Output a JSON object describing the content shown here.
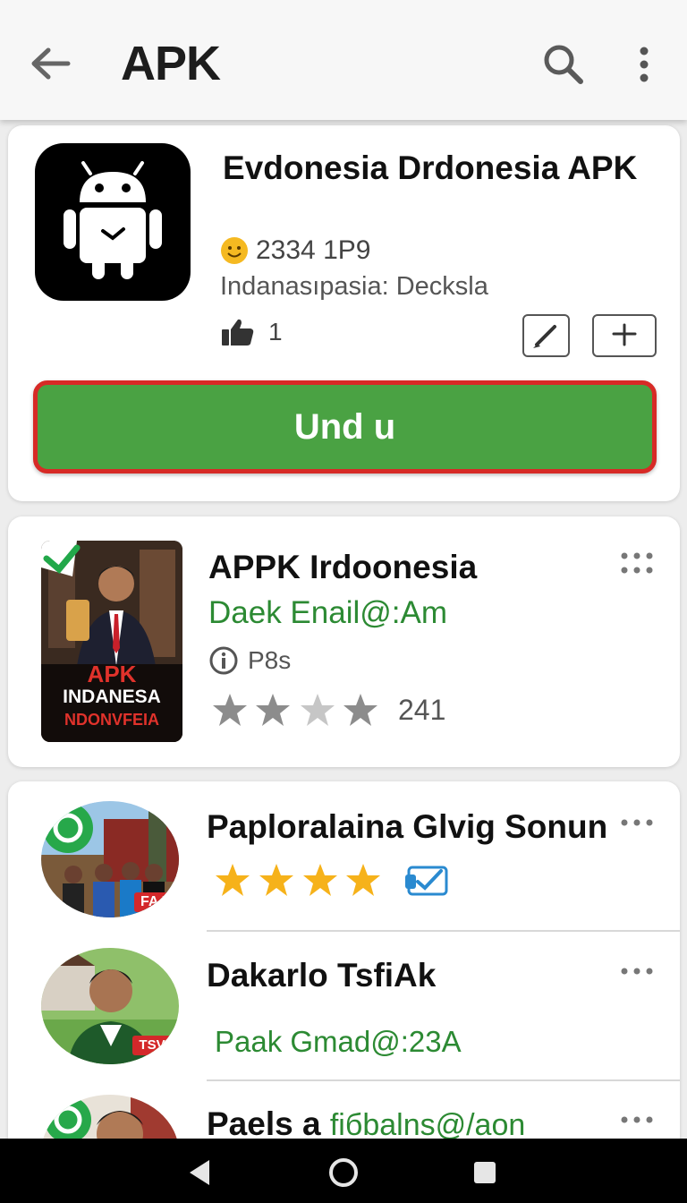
{
  "appbar": {
    "title": "APK",
    "back_icon": "arrow-left-icon",
    "search_icon": "search-icon",
    "more_icon": "more-vertical-icon"
  },
  "main_app": {
    "title": "Evdonesia Drdonesia APK",
    "rating_icon": "smiley-icon",
    "rating_text": "2334 1P9",
    "subtitle": "Indanasıpasia: Decksla",
    "likes_icon": "thumbs-up-icon",
    "likes": "1",
    "install_label": "Und u",
    "colors": {
      "install_bg": "#4aa243",
      "install_border": "#d72a26"
    }
  },
  "card2": {
    "title": "APPK Irdoonesia",
    "email": "Daek Enail@:Am",
    "size_icon": "info-icon",
    "size": "P8s",
    "rating": 3,
    "rating_max": 4,
    "reviews": "241",
    "thumb_text_top": "APK",
    "thumb_text_mid": "INDANESA",
    "thumb_text_bot": "NDONVFEIA"
  },
  "list": [
    {
      "title": "Paploralaina Glvig Sonun",
      "stars": 4,
      "badge_icon": "check-badge-icon",
      "avatar_tag": "FAA"
    },
    {
      "title": "Dakarlo TsfiAk",
      "green": "Paak Gmad@:23A",
      "avatar_tag": "TSV"
    },
    {
      "title_prefix": "Paels a",
      "green": "fiбbalns@/aon"
    }
  ],
  "navbar": {
    "back": "nav-back-icon",
    "home": "nav-home-icon",
    "recents": "nav-recents-icon"
  }
}
